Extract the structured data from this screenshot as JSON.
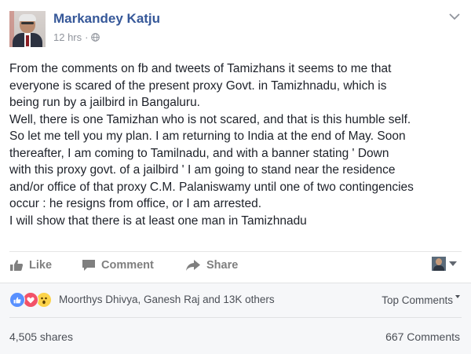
{
  "post": {
    "author": "Markandey Katju",
    "timestamp": "12 hrs",
    "separator": "·",
    "privacy_icon": "globe-icon",
    "options_icon": "chevron-down-icon",
    "lines": [
      "From the comments on fb and tweets of Tamizhans it seems to me that",
      "everyone is scared of the present proxy Govt. in Tamizhnadu, which is",
      "being run by a jailbird in Bangaluru.",
      "Well, there is one Tamizhan who is not scared, and that is this humble self.",
      "So let me tell you my plan. I am returning to India at the end of May. Soon",
      "thereafter, I am coming to Tamilnadu, and with a banner stating ' Down",
      "with this proxy govt. of a jailbird ' I am going to stand near the residence",
      "and/or office of that proxy C.M. Palaniswamy until one of two contingencies",
      "occur : he resigns from office, or I am arrested.",
      "I will show that there is at least one man in Tamizhnadu"
    ]
  },
  "actions": {
    "like": "Like",
    "comment": "Comment",
    "share": "Share"
  },
  "reactions": {
    "icons": [
      "like-reaction-icon",
      "love-reaction-icon",
      "wow-reaction-icon"
    ],
    "summary": "Moorthys Dhivya, Ganesh Raj and 13K others",
    "sort_label": "Top Comments"
  },
  "stats": {
    "shares": "4,505 shares",
    "comments": "667 Comments"
  },
  "colors": {
    "link_blue": "#365899",
    "text": "#1d2129",
    "muted": "#90949c",
    "panel_bg": "#f6f7f9",
    "like_blue": "#5890ff",
    "love_red": "#f25268",
    "wow_yellow": "#fcd34a"
  }
}
